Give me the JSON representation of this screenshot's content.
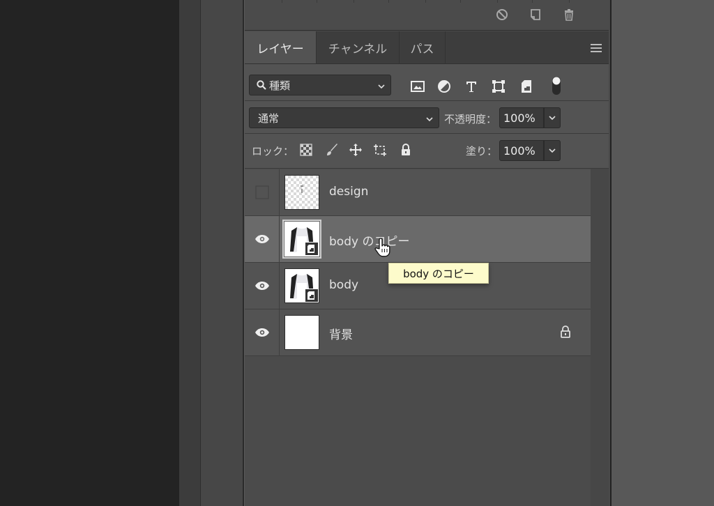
{
  "tabs": [
    {
      "label": "レイヤー",
      "active": true
    },
    {
      "label": "チャンネル",
      "active": false
    },
    {
      "label": "パス",
      "active": false
    }
  ],
  "filter": {
    "kind_label": "種類",
    "icons": [
      "image-filter-icon",
      "adjustment-filter-icon",
      "type-filter-icon",
      "shape-filter-icon",
      "smart-object-filter-icon",
      "filter-toggle-icon"
    ]
  },
  "blend": {
    "mode": "通常",
    "opacity_label": "不透明度：",
    "opacity_value": "100%"
  },
  "lock": {
    "label": "ロック：",
    "fill_label": "塗り：",
    "fill_value": "100%"
  },
  "layers": [
    {
      "name": "design",
      "visible": false,
      "selected": false
    },
    {
      "name": "body のコピー",
      "visible": true,
      "selected": true
    },
    {
      "name": "body",
      "visible": true,
      "selected": false
    },
    {
      "name": "背景",
      "visible": true,
      "selected": false,
      "locked": true
    }
  ],
  "tooltip": {
    "text": "body のコピー"
  },
  "colors": {
    "panel": "#535353",
    "selected_row": "#6a6a6a",
    "tooltip": "#fdfbcb"
  }
}
